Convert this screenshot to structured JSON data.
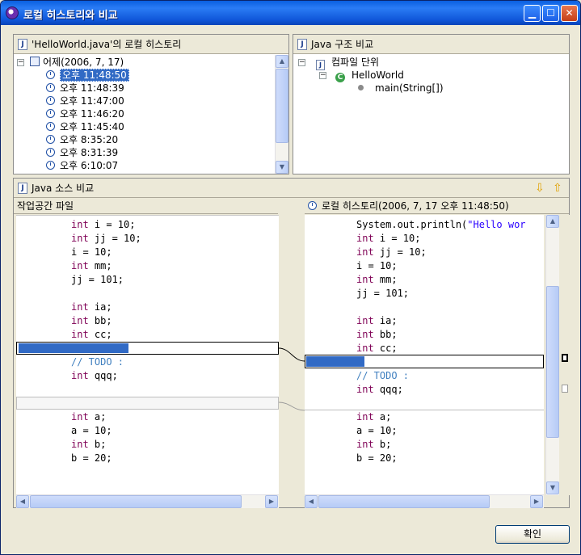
{
  "window": {
    "title": "로컬 히스토리와 비교"
  },
  "history_panel": {
    "title": "'HelloWorld.java'의 로컬 히스토리",
    "group": "어제(2006, 7, 17)",
    "entries": [
      "오후 11:48:50",
      "오후 11:48:39",
      "오후 11:47:00",
      "오후 11:46:20",
      "오후 11:45:40",
      "오후 8:35:20",
      "오후 8:31:39",
      "오후 6:10:07"
    ],
    "selected_index": 0
  },
  "structure_panel": {
    "title": "Java 구조 비교",
    "root": "컴파일 단위",
    "class_name": "HelloWorld",
    "method": "main(String[])"
  },
  "source_panel": {
    "title": "Java 소스 비교",
    "left_header": "작업공간 파일",
    "right_header": "로컬 히스토리(2006, 7, 17 오후 11:48:50)"
  },
  "left_code": {
    "l1": [
      "int",
      " i = 10;"
    ],
    "l2": [
      "int",
      " jj = 10;"
    ],
    "l3": "i = 10;",
    "l4": [
      "int",
      " mm;"
    ],
    "l5": "jj = 101;",
    "l6": [
      "int",
      " ia;"
    ],
    "l7": [
      "int",
      " bb;"
    ],
    "l8": [
      "int",
      " cc;"
    ],
    "l9": "// TODO :",
    "l10": [
      "int",
      " qqq;"
    ],
    "l11": [
      "int",
      " a;"
    ],
    "l12": "a = 10;",
    "l13": [
      "int",
      " b;"
    ],
    "l14": "b = 20;"
  },
  "right_code": {
    "r0": [
      "System.out.println(",
      "\"Hello wor"
    ],
    "r1": [
      "int",
      " i = 10;"
    ],
    "r2": [
      "int",
      " jj = 10;"
    ],
    "r3": "i = 10;",
    "r4": [
      "int",
      " mm;"
    ],
    "r5": "jj = 101;",
    "r6": [
      "int",
      " ia;"
    ],
    "r7": [
      "int",
      " bb;"
    ],
    "r8": [
      "int",
      " cc;"
    ],
    "r9": "// TODO :",
    "r10": [
      "int",
      " qqq;"
    ],
    "r11": [
      "int",
      " a;"
    ],
    "r12": "a = 10;",
    "r13": [
      "int",
      " b;"
    ],
    "r14": "b = 20;"
  },
  "buttons": {
    "ok": "확인"
  },
  "colors": {
    "titlebar": "#0a5fe0",
    "selection": "#316ac5",
    "keyword": "#7f0055",
    "comment": "#3f7fbf",
    "string": "#2a00ff"
  }
}
